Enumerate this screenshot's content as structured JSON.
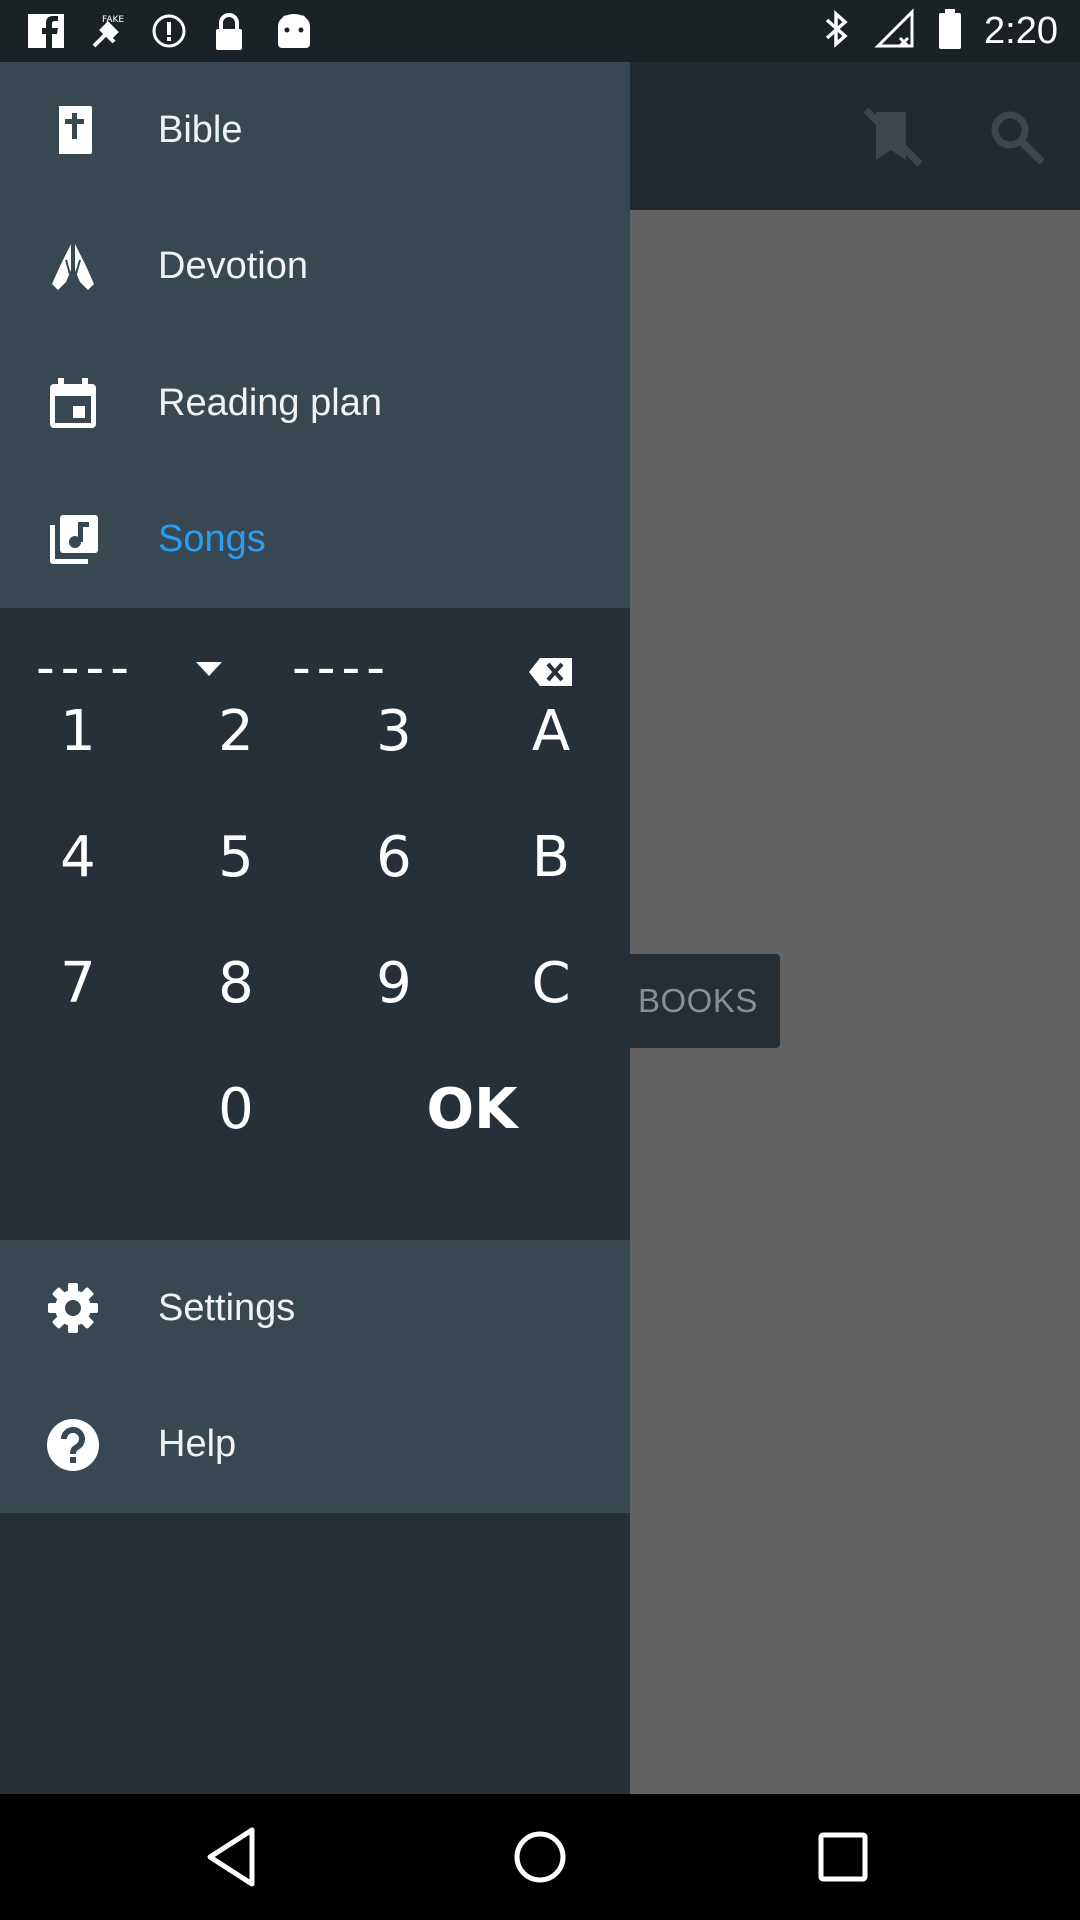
{
  "status_bar": {
    "time": "2:20",
    "icons": [
      "facebook-icon",
      "satellite-fake-gps-icon",
      "info-circle-icon",
      "lock-icon",
      "android-robot-icon",
      "bluetooth-icon",
      "no-signal-icon",
      "battery-icon"
    ]
  },
  "toolbar": {
    "actions": [
      "no-bookmark-icon",
      "search-icon"
    ]
  },
  "background": {
    "books_button_label": "BOOKS"
  },
  "drawer": {
    "top_items": [
      {
        "label": "Bible",
        "icon": "bible-icon"
      },
      {
        "label": "Devotion",
        "icon": "praying-hands-icon"
      },
      {
        "label": "Reading plan",
        "icon": "calendar-icon"
      },
      {
        "label": "Songs",
        "icon": "music-library-icon",
        "active": true
      }
    ],
    "keypad": {
      "book_placeholder": "----",
      "number_placeholder": "----",
      "keys": {
        "k1": "1",
        "k2": "2",
        "k3": "3",
        "kA": "A",
        "k4": "4",
        "k5": "5",
        "k6": "6",
        "kB": "B",
        "k7": "7",
        "k8": "8",
        "k9": "9",
        "kC": "C",
        "k0": "0",
        "ok": "OK"
      }
    },
    "bottom_items": [
      {
        "label": "Settings",
        "icon": "gear-icon"
      },
      {
        "label": "Help",
        "icon": "help-circle-icon"
      }
    ]
  },
  "colors": {
    "drawer_section": "#374852",
    "drawer_bg": "#273038",
    "active": "#2b9df0",
    "scrim": "#636363"
  }
}
